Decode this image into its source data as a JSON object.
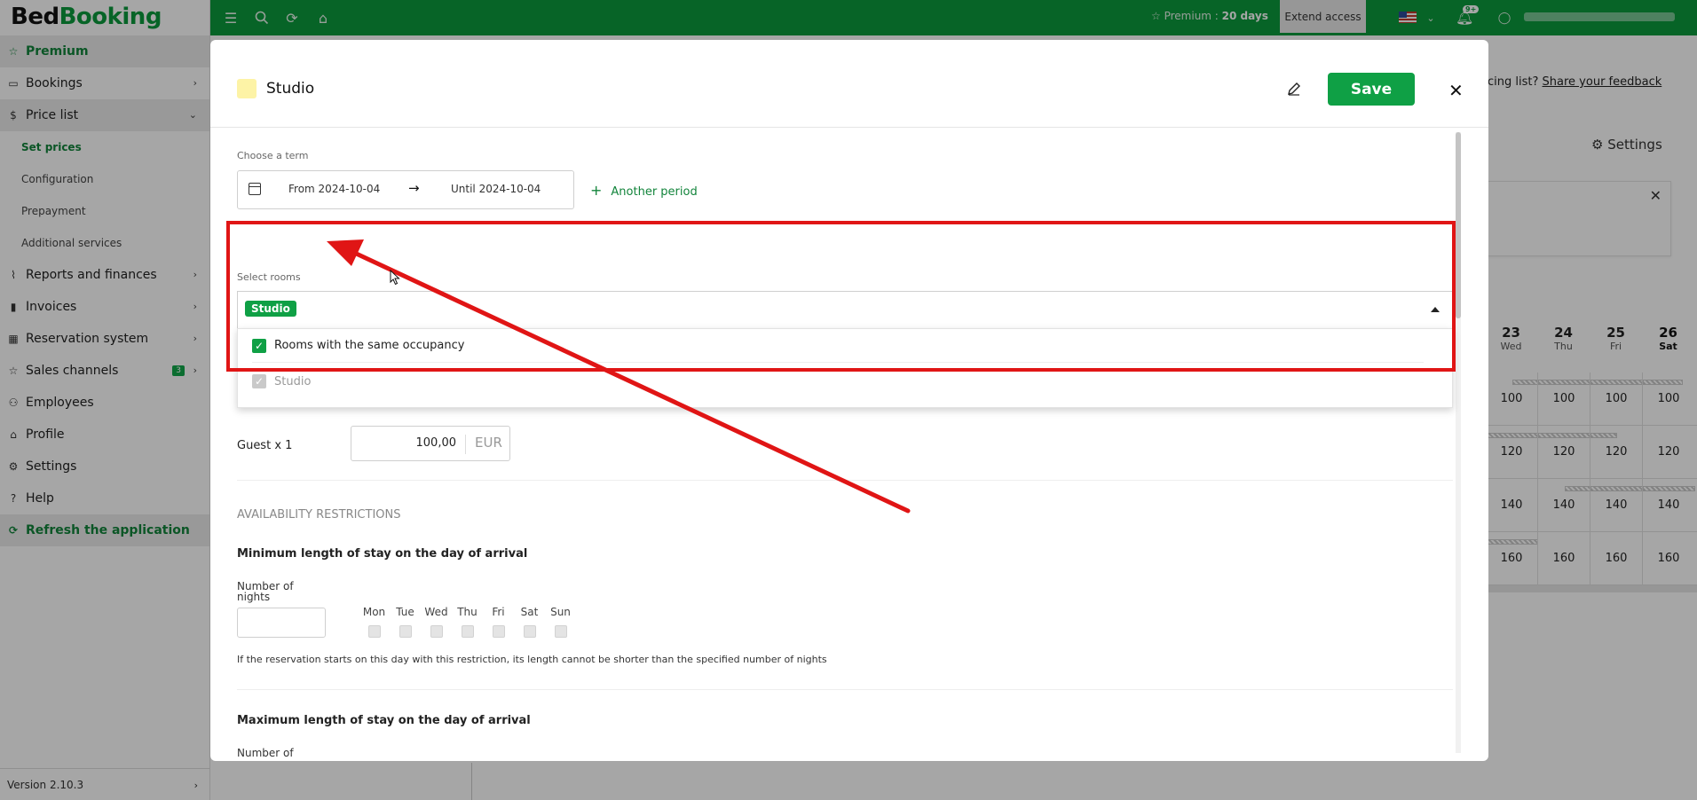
{
  "app": {
    "logo_part1": "Bed",
    "logo_part2": "Booking"
  },
  "sidebar": {
    "premium_label": "Premium",
    "items": [
      {
        "label": "Bookings",
        "icon": "calendar-icon"
      },
      {
        "label": "Price list",
        "icon": "dollar-icon"
      },
      {
        "label": "Reports and finances",
        "icon": "chart-icon"
      },
      {
        "label": "Invoices",
        "icon": "invoice-icon"
      },
      {
        "label": "Reservation system",
        "icon": "grid-icon"
      },
      {
        "label": "Sales channels",
        "icon": "star-icon",
        "badge": "3"
      },
      {
        "label": "Employees",
        "icon": "user-plus-icon"
      },
      {
        "label": "Profile",
        "icon": "building-icon"
      },
      {
        "label": "Settings",
        "icon": "gear-icon"
      },
      {
        "label": "Help",
        "icon": "help-icon"
      }
    ],
    "sub_items": [
      "Set prices",
      "Configuration",
      "Prepayment",
      "Additional services"
    ],
    "refresh_label": "Refresh the application",
    "version": "Version 2.10.3"
  },
  "topbar": {
    "premium_prefix": "Premium : ",
    "premium_days": "20 days",
    "extend_label": "Extend access",
    "notif_badge": "9+"
  },
  "background": {
    "feedback_prefix": "cing list?",
    "feedback_link": "Share your feedback",
    "settings_label": "Settings",
    "calendar_days": [
      {
        "num": "23",
        "dow": "Wed"
      },
      {
        "num": "24",
        "dow": "Thu"
      },
      {
        "num": "25",
        "dow": "Fri"
      },
      {
        "num": "26",
        "dow": "Sat"
      }
    ],
    "calendar_rows": [
      [
        "100",
        "100",
        "100",
        "100"
      ],
      [
        "120",
        "120",
        "120",
        "120"
      ],
      [
        "140",
        "140",
        "140",
        "140"
      ],
      [
        "160",
        "160",
        "160",
        "160"
      ]
    ]
  },
  "modal": {
    "title": "Studio",
    "swatch_color": "#fdf3a6",
    "save_label": "Save",
    "choose_term_label": "Choose a term",
    "date_from": "From 2024-10-04",
    "date_until": "Until 2024-10-04",
    "another_period": "Another period",
    "select_rooms_label": "Select rooms",
    "selected_chip": "Studio",
    "options": [
      {
        "label": "Rooms with the same occupancy",
        "checked": true
      },
      {
        "label": "Studio",
        "checked": true,
        "disabled": true
      }
    ],
    "guest_label": "Guest x 1",
    "price_value": "100,00",
    "currency": "EUR",
    "availability_title": "AVAILABILITY RESTRICTIONS",
    "min_stay_title": "Minimum length of stay on the day of arrival",
    "max_stay_title": "Maximum length of stay on the day of arrival",
    "nights_label": "Number of nights",
    "weekdays": [
      "Mon",
      "Tue",
      "Wed",
      "Thu",
      "Fri",
      "Sat",
      "Sun"
    ],
    "min_stay_hint": "If the reservation starts on this day with this restriction, its length cannot be shorter than the specified number of nights"
  },
  "colors": {
    "brand_green": "#0c9a3c",
    "save_green": "#0fa045",
    "annotation_red": "#e01515"
  }
}
